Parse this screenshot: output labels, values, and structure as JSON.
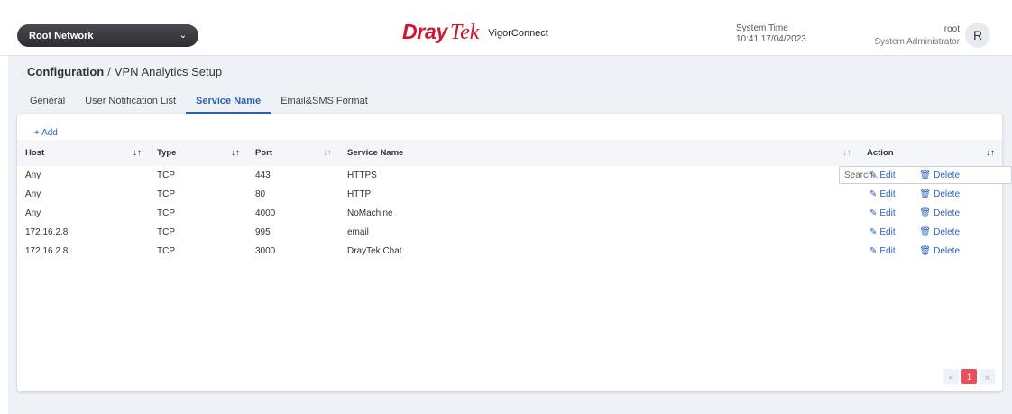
{
  "header": {
    "network_selector": "Root Network",
    "logo_brand_a": "Dray",
    "logo_brand_b": "Tek",
    "product_name": "VigorConnect",
    "system_time_label": "System Time",
    "system_time_value": "10:41 17/04/2023",
    "user_name": "root",
    "user_role": "System Administrator",
    "avatar_initial": "R"
  },
  "breadcrumb": {
    "root": "Configuration",
    "separator": "/",
    "current": "VPN Analytics Setup"
  },
  "tabs": [
    {
      "label": "General",
      "active": false
    },
    {
      "label": "User Notification List",
      "active": false
    },
    {
      "label": "Service Name",
      "active": true
    },
    {
      "label": "Email&SMS Format",
      "active": false
    }
  ],
  "toolbar": {
    "add_label": "+ Add",
    "search_placeholder": "Search..."
  },
  "table": {
    "columns": [
      "Host",
      "Type",
      "Port",
      "Service Name",
      "Action"
    ],
    "rows": [
      {
        "host": "Any",
        "type": "TCP",
        "port": "443",
        "service_name": "HTTPS"
      },
      {
        "host": "Any",
        "type": "TCP",
        "port": "80",
        "service_name": "HTTP"
      },
      {
        "host": "Any",
        "type": "TCP",
        "port": "4000",
        "service_name": "NoMachine"
      },
      {
        "host": "172.16.2.8",
        "type": "TCP",
        "port": "995",
        "service_name": "email"
      },
      {
        "host": "172.16.2.8",
        "type": "TCP",
        "port": "3000",
        "service_name": "DrayTek.Chat"
      }
    ],
    "edit_label": "Edit",
    "delete_label": "Delete"
  },
  "pagination": {
    "first": "«",
    "current_page": "1",
    "last": "»"
  },
  "colors": {
    "brand_red": "#d2152a",
    "accent_blue": "#2f62b8",
    "page_active": "#e8505b",
    "background": "#eef1f6"
  }
}
